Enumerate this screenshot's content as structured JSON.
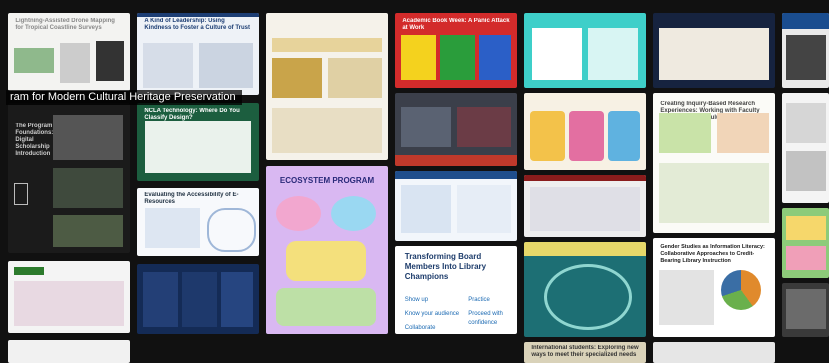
{
  "hover_title": "ram for Modern Cultural Heritage Preservation",
  "posters": [
    {
      "id": "p1",
      "title": "Lightning-Assisted Drone Mapping for Tropical Coastline Surveys"
    },
    {
      "id": "p2",
      "title": "A Kind of Leadership: Using Kindness to Foster a Culture of Trust"
    },
    {
      "id": "p3",
      "title": ""
    },
    {
      "id": "p4",
      "title": "Academic Book Week: A Panic Attack at Work"
    },
    {
      "id": "p5",
      "title": ""
    },
    {
      "id": "p6",
      "title": ""
    },
    {
      "id": "p7",
      "title": ""
    },
    {
      "id": "p8",
      "title": "The Program Foundations: Digital Scholarship Introduction"
    },
    {
      "id": "p9",
      "title": "NCLA Technology: Where Do You Classify Design?"
    },
    {
      "id": "p10",
      "title": ""
    },
    {
      "id": "p11",
      "title": ""
    },
    {
      "id": "p12",
      "title": ""
    },
    {
      "id": "p13",
      "title": "Creating Inquiry-Based Research Experiences: Working with Faculty Across the Curriculum"
    },
    {
      "id": "p14",
      "title": "Evaluating the Accessibility of E-Resources"
    },
    {
      "id": "p15",
      "title": "ECOSYSTEM PROGRAM"
    },
    {
      "id": "p16",
      "title": ""
    },
    {
      "id": "p17",
      "title": ""
    },
    {
      "id": "p18",
      "title": ""
    },
    {
      "id": "p19",
      "title": "Gender Studies as Information Literacy: Collaborative Approaches to Credit-Bearing Library Instruction"
    },
    {
      "id": "p20",
      "title": "Transforming Board Members Into Library Champions"
    },
    {
      "id": "p21",
      "title": ""
    },
    {
      "id": "p22",
      "title": ""
    },
    {
      "id": "p23",
      "title": "International students: Exploring new ways to meet their specialized needs"
    }
  ],
  "tile_labels": {
    "t20_sub1": "Show up",
    "t20_sub2": "Practice",
    "t20_sub3": "Know your audience",
    "t20_sub4": "Proceed with confidence",
    "t20_sub5": "Collaborate"
  },
  "colors": {
    "background": "#111111",
    "banner_bg": "rgba(0,0,0,0.75)"
  }
}
